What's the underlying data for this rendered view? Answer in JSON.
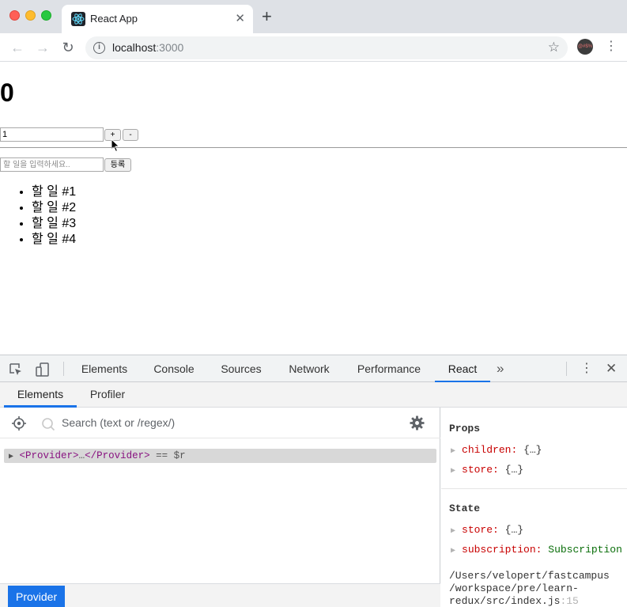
{
  "browser": {
    "tab_title": "React App",
    "url_host": "localhost",
    "url_port": ":3000",
    "profile_avatar_text": "@#$%"
  },
  "page": {
    "counter_value": "0",
    "diff_value": "1",
    "increase_label": "+",
    "decrease_label": "-",
    "todo_placeholder": "할 일을 입력하세요..",
    "register_label": "등록",
    "todos": [
      "할 일 #1",
      "할 일 #2",
      "할 일 #3",
      "할 일 #4"
    ]
  },
  "devtools": {
    "tabs": [
      "Elements",
      "Console",
      "Sources",
      "Network",
      "Performance",
      "React"
    ],
    "active_tab": "React",
    "react_tabs": [
      "Elements",
      "Profiler"
    ],
    "active_react_tab": "Elements",
    "search_placeholder": "Search (text or /regex/)",
    "tree_row": {
      "open_tag": "<Provider>",
      "ellipsis": "…",
      "close_tag": "</Provider>",
      "suffix": " == $r"
    },
    "breadcrumb": "Provider",
    "props_title": "Props",
    "props": [
      {
        "key": "children:",
        "value": "{…}"
      },
      {
        "key": "store:",
        "value": "{…}"
      }
    ],
    "state_title": "State",
    "state": [
      {
        "key": "store:",
        "value": "{…}"
      },
      {
        "key": "subscription:",
        "value": "Subscription"
      }
    ],
    "source_path": "/Users/velopert/fastcampus\n/workspace/pre/learn-\nredux/src/index.js",
    "source_line": ":15"
  },
  "colors": {
    "accent": "#1a73e8",
    "tag": "#881280",
    "prop_key": "#c80000"
  }
}
